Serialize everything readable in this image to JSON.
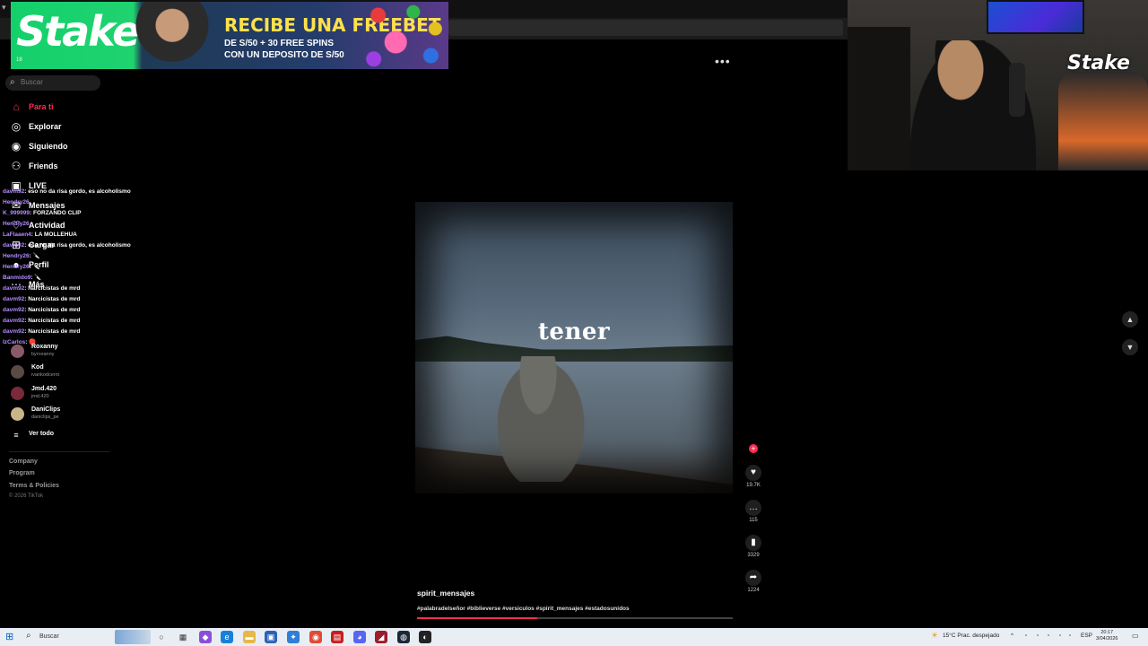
{
  "ad": {
    "brand": "Stake",
    "headline": "RECIBE UNA FREEBET",
    "line1": "DE S/50 + 30 FREE SPINS",
    "line2": "CON UN DEPOSITO DE S/50",
    "age": "18"
  },
  "search": {
    "placeholder": "Buscar"
  },
  "nav": [
    {
      "label": "Para ti",
      "icon": "home-icon"
    },
    {
      "label": "Explorar",
      "icon": "compass-icon"
    },
    {
      "label": "Siguiendo",
      "icon": "following-icon"
    },
    {
      "label": "Friends",
      "icon": "friends-icon"
    },
    {
      "label": "LIVE",
      "icon": "live-icon"
    },
    {
      "label": "Mensajes",
      "icon": "messages-icon"
    },
    {
      "label": "Actividad",
      "icon": "activity-icon"
    },
    {
      "label": "Cargar",
      "icon": "upload-icon"
    },
    {
      "label": "Perfil",
      "icon": "profile-icon"
    },
    {
      "label": "Más",
      "icon": "more-icon"
    }
  ],
  "chat": [
    {
      "user": "davm92",
      "text": ": eso no da risa gordo, es alcoholismo"
    },
    {
      "user": "Hendry26",
      "text": ""
    },
    {
      "user": "K_999999",
      "text": ": FORZANDO CLIP"
    },
    {
      "user": "Hendry26",
      "text": ""
    },
    {
      "user": "LaFlaaen4",
      "text": ": LA MOLLEHUA"
    },
    {
      "user": "davm92",
      "text": ": eso no da risa gordo, es alcoholismo"
    },
    {
      "user": "Hendry26",
      "text": ": 🔪"
    },
    {
      "user": "Hendry26",
      "text": ": 🔪"
    },
    {
      "user": "Banmido9",
      "text": ": 🔪"
    },
    {
      "user": "davm92",
      "text": ": Narcicistas de mrd"
    },
    {
      "user": "davm92",
      "text": ": Narcicistas de mrd"
    },
    {
      "user": "davm92",
      "text": ": Narcicistas de mrd"
    },
    {
      "user": "davm92",
      "text": ": Narcicistas de mrd"
    },
    {
      "user": "davm92",
      "text": ": Narcicistas de mrd"
    },
    {
      "user": "IzCarlos",
      "text": ": 🔴"
    }
  ],
  "following": [
    {
      "name": "Roxanny",
      "handle": "byroxanny"
    },
    {
      "name": "Kod",
      "handle": "ivankodcerro"
    },
    {
      "name": "Jmd.420",
      "handle": "jmd.420"
    },
    {
      "name": "DaniClips",
      "handle": "daniclips_pe"
    }
  ],
  "see_all": "Ver todo",
  "footer": {
    "company": "Company",
    "program": "Program",
    "terms": "Terms & Policies",
    "copyright": "© 2026 TikTok"
  },
  "video": {
    "overlay_word": "tener",
    "author": "spirit_mensajes",
    "hashtags": "#palabradelseñor #biblieverse #versiculos #spirit_mensajes #estadosunidos",
    "progress": 0.38
  },
  "actions": {
    "likes": "19.7K",
    "comments": "115",
    "saves": "3329",
    "shares": "1224"
  },
  "taskbar": {
    "search_placeholder": "Buscar",
    "weather": "15°C  Prac. despejado",
    "lang": "ESP",
    "time": "20:17",
    "date": "3/04/2026"
  }
}
